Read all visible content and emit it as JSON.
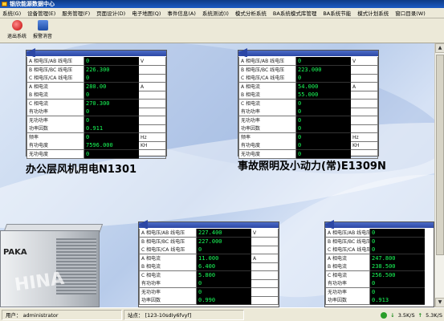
{
  "window": {
    "title": "银欣能源数据中心"
  },
  "menu": [
    "系统(G)",
    "设备管理(E)",
    "服务管理(F)",
    "页面设计(D)",
    "电子地图(Q)",
    "事件信息(A)",
    "系统测试(I)",
    "模式分析系统",
    "BA系统模式库管理",
    "BA系统节能",
    "模式计划系统",
    "窗口目录(W)"
  ],
  "toolbar": {
    "exit_label": "退出系统",
    "alarm_label": "报警消音"
  },
  "panels": [
    {
      "caption": "办公层风机用电N1301",
      "rows": [
        {
          "label": "A 相电压/AB 线电压",
          "value": "0",
          "unit": "V"
        },
        {
          "label": "B 相电压/BC 线电压",
          "value": "226.300",
          "unit": ""
        },
        {
          "label": "C 相电压/CA 线电压",
          "value": "0",
          "unit": ""
        },
        {
          "label": "A 相电流",
          "value": "280.00",
          "unit": "A"
        },
        {
          "label": "B 相电流",
          "value": "0",
          "unit": ""
        },
        {
          "label": "C 相电流",
          "value": "270.300",
          "unit": ""
        },
        {
          "label": "有功功率",
          "value": "0",
          "unit": ""
        },
        {
          "label": "无功功率",
          "value": "0",
          "unit": ""
        },
        {
          "label": "功率因数",
          "value": "0.911",
          "unit": ""
        },
        {
          "label": "频率",
          "value": "0",
          "unit": "Hz"
        },
        {
          "label": "有功电度",
          "value": "7596.000",
          "unit": "KH"
        },
        {
          "label": "无功电度",
          "value": "0",
          "unit": ""
        }
      ]
    },
    {
      "caption": "事故照明及小动力(常)E1309N",
      "rows": [
        {
          "label": "A 相电压/AB 线电压",
          "value": "0",
          "unit": "V"
        },
        {
          "label": "B 相电压/BC 线电压",
          "value": "223.000",
          "unit": ""
        },
        {
          "label": "C 相电压/CA 线电压",
          "value": "0",
          "unit": ""
        },
        {
          "label": "A 相电流",
          "value": "54.000",
          "unit": "A"
        },
        {
          "label": "B 相电流",
          "value": "55.000",
          "unit": ""
        },
        {
          "label": "C 相电流",
          "value": "0",
          "unit": ""
        },
        {
          "label": "有功功率",
          "value": "0",
          "unit": ""
        },
        {
          "label": "无功功率",
          "value": "0",
          "unit": ""
        },
        {
          "label": "功率因数",
          "value": "0",
          "unit": ""
        },
        {
          "label": "频率",
          "value": "0",
          "unit": "Hz"
        },
        {
          "label": "有功电度",
          "value": "0",
          "unit": "KH"
        },
        {
          "label": "无功电度",
          "value": "0",
          "unit": ""
        }
      ]
    },
    {
      "caption": "",
      "rows": [
        {
          "label": "A 相电压/AB 线电压",
          "value": "227.400",
          "unit": "V"
        },
        {
          "label": "B 相电压/BC 线电压",
          "value": "227.000",
          "unit": ""
        },
        {
          "label": "C 相电压/CA 线电压",
          "value": "0",
          "unit": ""
        },
        {
          "label": "A 相电流",
          "value": "11.000",
          "unit": "A"
        },
        {
          "label": "B 相电流",
          "value": "6.400",
          "unit": ""
        },
        {
          "label": "C 相电流",
          "value": "5.800",
          "unit": ""
        },
        {
          "label": "有功功率",
          "value": "0",
          "unit": ""
        },
        {
          "label": "无功功率",
          "value": "0",
          "unit": ""
        },
        {
          "label": "功率因数",
          "value": "0.990",
          "unit": ""
        }
      ]
    },
    {
      "caption": "",
      "rows": [
        {
          "label": "A 相电压/AB 线电压",
          "value": "0",
          "unit": ""
        },
        {
          "label": "B 相电压/BC 线电压",
          "value": "0",
          "unit": ""
        },
        {
          "label": "C 相电压/CA 线电压",
          "value": "0",
          "unit": ""
        },
        {
          "label": "A 相电流",
          "value": "247.800",
          "unit": ""
        },
        {
          "label": "B 相电流",
          "value": "238.500",
          "unit": ""
        },
        {
          "label": "C 相电流",
          "value": "256.500",
          "unit": ""
        },
        {
          "label": "有功功率",
          "value": "0",
          "unit": ""
        },
        {
          "label": "无功功率",
          "value": "0",
          "unit": ""
        },
        {
          "label": "功率因数",
          "value": "0.913",
          "unit": ""
        }
      ]
    }
  ],
  "device": {
    "brand": "PAKA",
    "text": "HINA"
  },
  "status": {
    "user_label": "用户：",
    "user": "administrator",
    "station_label": "站点：",
    "station": "[123-10sdIy6fvyf]",
    "up": "3.5K/S",
    "down": "5.3K/S"
  },
  "colors": {
    "titlebar": "#1c5bc3",
    "panel_header": "#2c47a5",
    "value_bg": "#000000",
    "value_text": "#19ff5a"
  }
}
